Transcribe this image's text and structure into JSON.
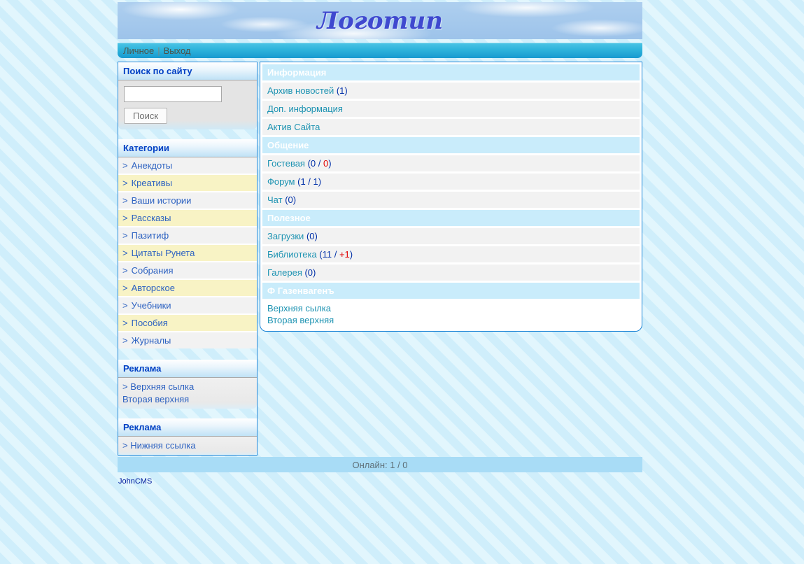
{
  "logo": "Логотип",
  "nav": {
    "personal": "Личное",
    "sep": "|",
    "logout": "Выход"
  },
  "sidebar": {
    "search": {
      "title": "Поиск по сайту",
      "input_value": "",
      "button": "Поиск"
    },
    "categories": {
      "title": "Категории",
      "prefix": ">",
      "items": [
        "Анекдоты",
        "Креативы",
        "Ваши истории",
        "Рассказы",
        "Пазитиф",
        "Цитаты Рунета",
        "Собрания",
        "Авторское",
        "Учебники",
        "Пособия",
        "Журналы"
      ]
    },
    "ads_top": {
      "title": "Реклама",
      "links": [
        "> Верхняя сылка",
        "Вторая верхняя"
      ]
    },
    "ads_bottom": {
      "title": "Реклама",
      "links": [
        "> Нижняя ссылка"
      ]
    }
  },
  "main": {
    "sections": [
      {
        "title": "Информация",
        "items": [
          {
            "text": "Архив новостей",
            "count": " (1)"
          },
          {
            "text": "Доп. информация"
          },
          {
            "text": "Актив Сайта"
          }
        ]
      },
      {
        "title": "Общение",
        "items": [
          {
            "text": "Гостевая",
            "count": " (0 / ",
            "red": "0",
            "count2": ")"
          },
          {
            "text": "Форум",
            "count": " (1 / 1)"
          },
          {
            "text": "Чат",
            "count": " (0)"
          }
        ]
      },
      {
        "title": "Полезное",
        "items": [
          {
            "text": "Загрузки",
            "count": " (0)"
          },
          {
            "text": "Библиотека",
            "count": " (11 / ",
            "red": "+1",
            "count2": ")"
          },
          {
            "text": "Галерея",
            "count": " (0)"
          }
        ]
      },
      {
        "title": "Ф Газенвагенъ",
        "links": [
          "Верхняя сылка",
          "Вторая верхняя"
        ]
      }
    ]
  },
  "footer": {
    "online": "Онлайн: 1 / 0",
    "cms": "JohnCMS"
  },
  "colors": {
    "nav_gradient_top": "#4cc5e6",
    "nav_gradient_bottom": "#189ad0",
    "section_header_bg": "#c9ecfb",
    "row_bg": "#f2f2f2",
    "row_alt_bg": "#f8f3c5",
    "border_blue": "#1d85d6",
    "link_teal": "#1d93b2",
    "link_blue": "#2d62c1",
    "count_navy": "#0030a8",
    "count_red": "#e00000",
    "online_bar_bg": "#a8dcf6"
  }
}
